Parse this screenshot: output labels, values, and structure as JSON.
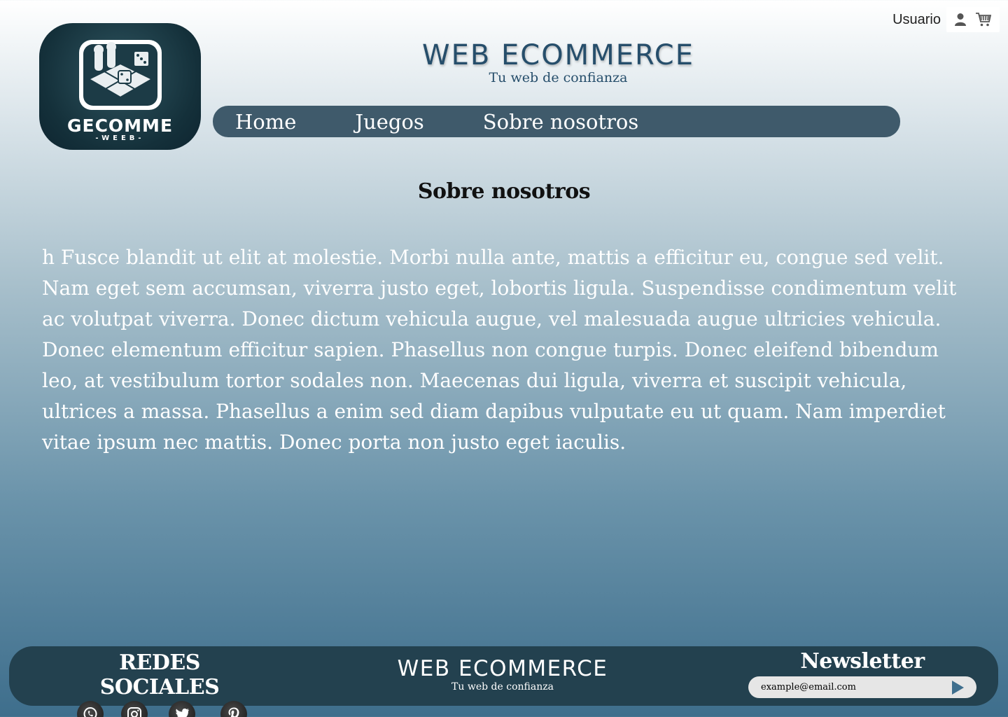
{
  "header": {
    "user_label": "Usuario",
    "user_icon": "user-icon",
    "cart_icon": "cart-icon"
  },
  "logo": {
    "title": "GECOMME",
    "subtitle": "-WEEB-"
  },
  "brand": {
    "title": "WEB ECOMMERCE",
    "subtitle": "Tu web de confianza"
  },
  "nav": {
    "items": [
      {
        "label": "Home"
      },
      {
        "label": "Juegos"
      },
      {
        "label": "Sobre nosotros"
      }
    ]
  },
  "main": {
    "heading": "Sobre nosotros",
    "body": "h Fusce blandit ut elit at molestie. Morbi nulla ante, mattis a efficitur eu, congue sed velit. Nam eget sem accumsan, viverra justo eget, lobortis ligula. Suspendisse condimentum velit ac volutpat viverra. Donec dictum vehicula augue, vel malesuada augue ultricies vehicula. Donec elementum efficitur sapien. Phasellus non congue turpis. Donec eleifend bibendum leo, at vestibulum tortor sodales non. Maecenas dui ligula, viverra et suscipit vehicula, ultrices a massa. Phasellus a enim sed diam dapibus vulputate eu ut quam. Nam imperdiet vitae ipsum nec mattis. Donec porta non justo eget iaculis."
  },
  "footer": {
    "social_title": "REDES SOCIALES",
    "social_icons": [
      "whatsapp-icon",
      "instagram-icon",
      "twitter-icon",
      "pinterest-icon"
    ],
    "brand_title": "WEB ECOMMERCE",
    "brand_subtitle": "Tu web de confianza",
    "newsletter_title": "Newsletter",
    "newsletter_value": "example@email.com"
  },
  "colors": {
    "nav_bg": "#3f5a6b",
    "footer_bg": "#23414f",
    "brand_text": "#264e6b"
  }
}
